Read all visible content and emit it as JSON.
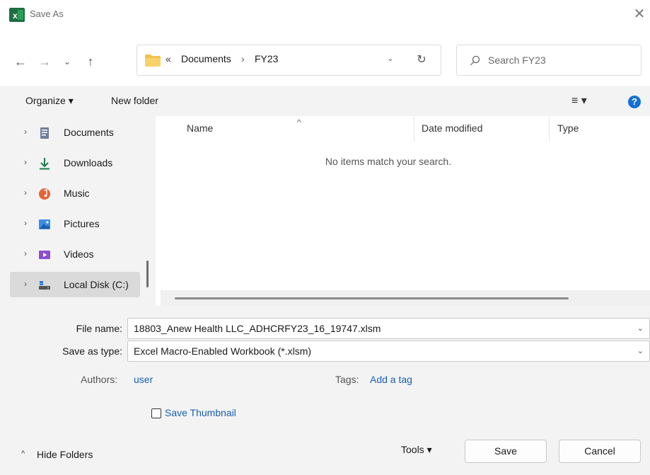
{
  "window": {
    "title": "Save As",
    "close_glyph": "✕"
  },
  "nav": {
    "back_glyph": "←",
    "forward_glyph": "→",
    "recent_glyph": "⌄",
    "up_glyph": "↑",
    "address": {
      "chevrons": "«",
      "segments": [
        "Documents",
        "FY23"
      ],
      "separator": "›",
      "dropdown_glyph": "⌄",
      "refresh_glyph": "↻"
    },
    "search": {
      "placeholder": "Search FY23",
      "value": ""
    }
  },
  "toolbar": {
    "organize_label": "Organize ▾",
    "new_folder_label": "New folder",
    "view_glyph": "≡ ▾",
    "help_glyph": "?"
  },
  "sidebar": {
    "items": [
      {
        "label": "Documents",
        "icon": "documents-icon",
        "selected": false
      },
      {
        "label": "Downloads",
        "icon": "downloads-icon",
        "selected": false
      },
      {
        "label": "Music",
        "icon": "music-icon",
        "selected": false
      },
      {
        "label": "Pictures",
        "icon": "pictures-icon",
        "selected": false
      },
      {
        "label": "Videos",
        "icon": "videos-icon",
        "selected": false
      },
      {
        "label": "Local Disk (C:)",
        "icon": "local-disk-icon",
        "selected": true
      }
    ],
    "chevron_glyph": "›"
  },
  "filelist": {
    "sort_glyph": "^",
    "columns": [
      "Name",
      "Date modified",
      "Type"
    ],
    "empty_message": "No items match your search."
  },
  "form": {
    "file_name_label": "File name:",
    "file_name_value": "18803_Anew Health LLC_ADHCRFY23_16_19747.xlsm",
    "save_type_label": "Save as type:",
    "save_type_value": "Excel Macro-Enabled Workbook (*.xlsm)",
    "dropdown_glyph": "⌄",
    "authors_label": "Authors:",
    "authors_value": "user",
    "tags_label": "Tags:",
    "tags_value": "Add a tag",
    "save_thumbnail_label": "Save Thumbnail",
    "save_thumbnail_checked": false
  },
  "footer": {
    "hide_folders_glyph": "^",
    "hide_folders_label": "Hide Folders",
    "tools_label": "Tools  ▾",
    "save_label": "Save",
    "cancel_label": "Cancel"
  },
  "colors": {
    "accent": "#1a5fb4",
    "excel_green": "#1d6f42",
    "folder_yellow": "#f2c14e",
    "help_blue": "#1570d8"
  }
}
